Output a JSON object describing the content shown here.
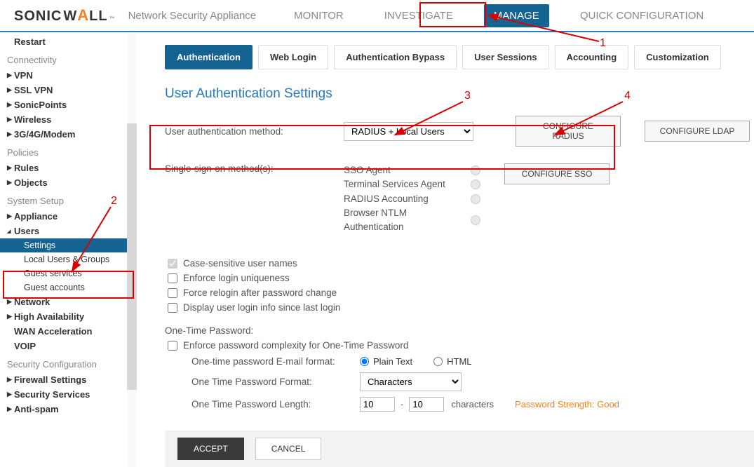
{
  "header": {
    "logo_left": "SONIC",
    "logo_right": "WALL",
    "subtitle": "Network Security Appliance",
    "nav": [
      "MONITOR",
      "INVESTIGATE",
      "MANAGE",
      "QUICK CONFIGURATION"
    ],
    "active_nav": "MANAGE"
  },
  "sidebar": {
    "top_item": "Restart",
    "groups": [
      {
        "title": "Connectivity",
        "items": [
          "VPN",
          "SSL VPN",
          "SonicPoints",
          "Wireless",
          "3G/4G/Modem"
        ]
      },
      {
        "title": "Policies",
        "items": [
          "Rules",
          "Objects"
        ]
      },
      {
        "title": "System Setup",
        "items": [
          "Appliance"
        ],
        "users_label": "Users",
        "users_children": [
          "Settings",
          "Local Users & Groups",
          "Guest services",
          "Guest accounts"
        ],
        "after_users": [
          "Network",
          "High Availability"
        ],
        "plain_after": [
          "WAN Acceleration",
          "VOIP"
        ]
      },
      {
        "title": "Security Configuration",
        "items": [
          "Firewall Settings",
          "Security Services",
          "Anti-spam"
        ]
      }
    ]
  },
  "tabs": [
    "Authentication",
    "Web Login",
    "Authentication Bypass",
    "User Sessions",
    "Accounting",
    "Customization"
  ],
  "active_tab": "Authentication",
  "section_title": "User Authentication Settings",
  "auth_method": {
    "label": "User authentication method:",
    "value": "RADIUS + Local Users",
    "btn_radius": "CONFIGURE RADIUS",
    "btn_ldap": "CONFIGURE LDAP"
  },
  "sso": {
    "label": "Single-sign-on method(s):",
    "methods": [
      "SSO Agent",
      "Terminal Services Agent",
      "RADIUS Accounting",
      "Browser NTLM Authentication"
    ],
    "btn": "CONFIGURE SSO"
  },
  "checkboxes": {
    "case_sensitive": "Case-sensitive user names",
    "enforce_unique": "Enforce login uniqueness",
    "force_relogin": "Force relogin after password change",
    "display_login_info": "Display user login info since last login"
  },
  "otp": {
    "heading": "One-Time Password:",
    "enforce": "Enforce password complexity for One-Time Password",
    "email_format_label": "One-time password E-mail format:",
    "radio_plain": "Plain Text",
    "radio_html": "HTML",
    "format_label": "One Time Password Format:",
    "format_value": "Characters",
    "length_label": "One Time Password Length:",
    "length_min": "10",
    "length_max": "10",
    "length_suffix": "characters",
    "strength": "Password Strength: Good"
  },
  "footer": {
    "accept": "ACCEPT",
    "cancel": "CANCEL"
  },
  "annotations": {
    "1": "1",
    "2": "2",
    "3": "3",
    "4": "4"
  }
}
